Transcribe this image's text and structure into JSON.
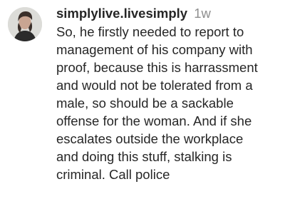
{
  "comment": {
    "username": "simplylive.livesimply",
    "timestamp": "1w",
    "text": "So, he firstly needed to report to\nmanagement of his company with\nproof, because this is harrassment\nand would not be tolerated from a\nmale, so should be a sackable\noffense for the woman. And if she\nescalates outside the workplace\nand doing this stuff, stalking is\ncriminal. Call police"
  },
  "colors": {
    "text": "#262626",
    "secondary_text": "#8e8e8e",
    "background": "#ffffff"
  }
}
